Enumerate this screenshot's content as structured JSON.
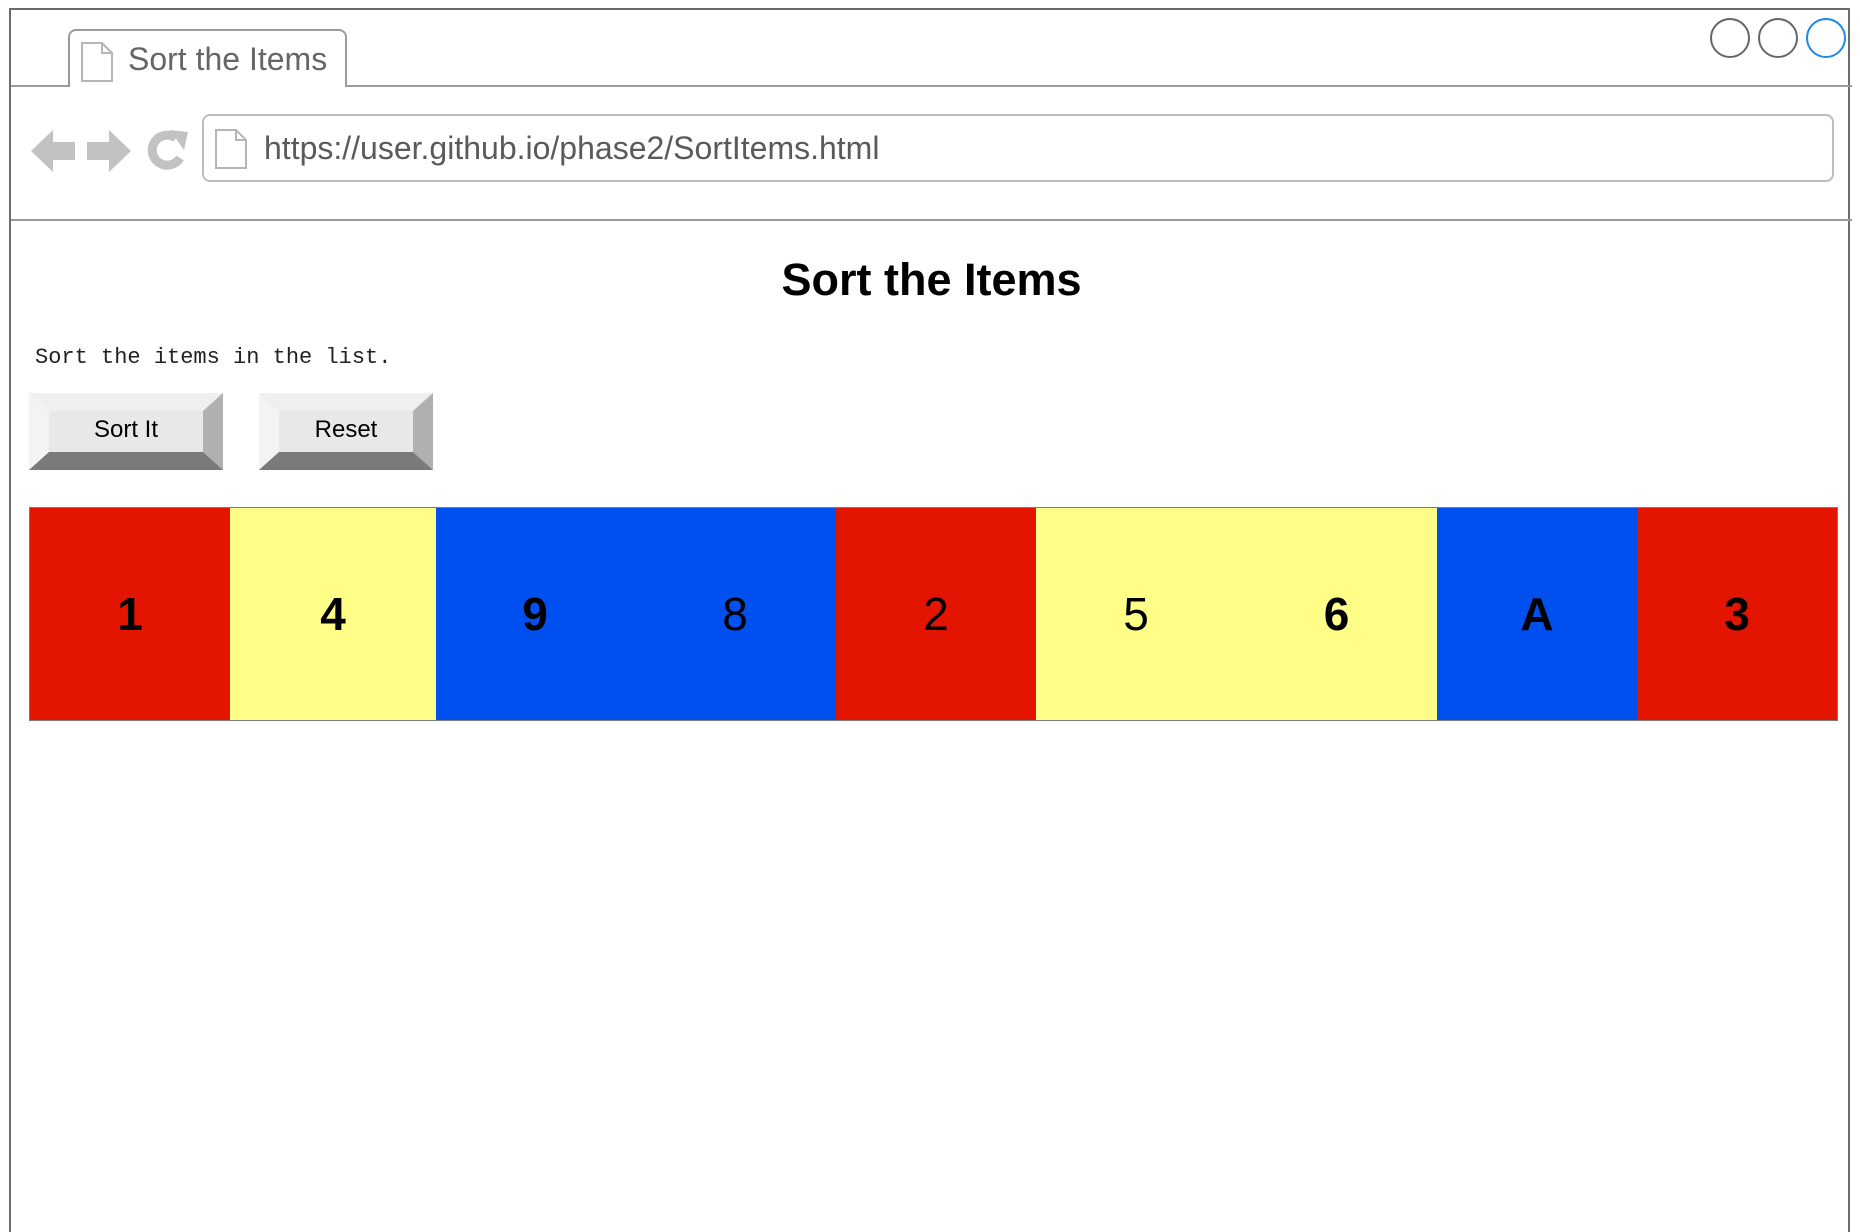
{
  "browser": {
    "tab_title": "Sort the Items",
    "url": "https://user.github.io/phase2/SortItems.html",
    "icons": {
      "back": "back-arrow-icon",
      "forward": "forward-arrow-icon",
      "reload": "reload-icon",
      "page": "document-icon"
    }
  },
  "page": {
    "title": "Sort the Items",
    "instructions": "Sort the items in the list.",
    "buttons": {
      "sort_label": "Sort It",
      "reset_label": "Reset"
    },
    "items": [
      {
        "label": "1",
        "color": "red",
        "bold": true
      },
      {
        "label": "4",
        "color": "yellow",
        "bold": true
      },
      {
        "label": "9",
        "color": "blue",
        "bold": true
      },
      {
        "label": "8",
        "color": "blue",
        "bold": false
      },
      {
        "label": "2",
        "color": "red",
        "bold": false
      },
      {
        "label": "5",
        "color": "yellow",
        "bold": false
      },
      {
        "label": "6",
        "color": "yellow",
        "bold": true
      },
      {
        "label": "A",
        "color": "blue",
        "bold": true
      },
      {
        "label": "3",
        "color": "red",
        "bold": true
      }
    ],
    "colors": {
      "red": "#e31400",
      "yellow": "#ffff88",
      "blue": "#0050ef"
    }
  }
}
